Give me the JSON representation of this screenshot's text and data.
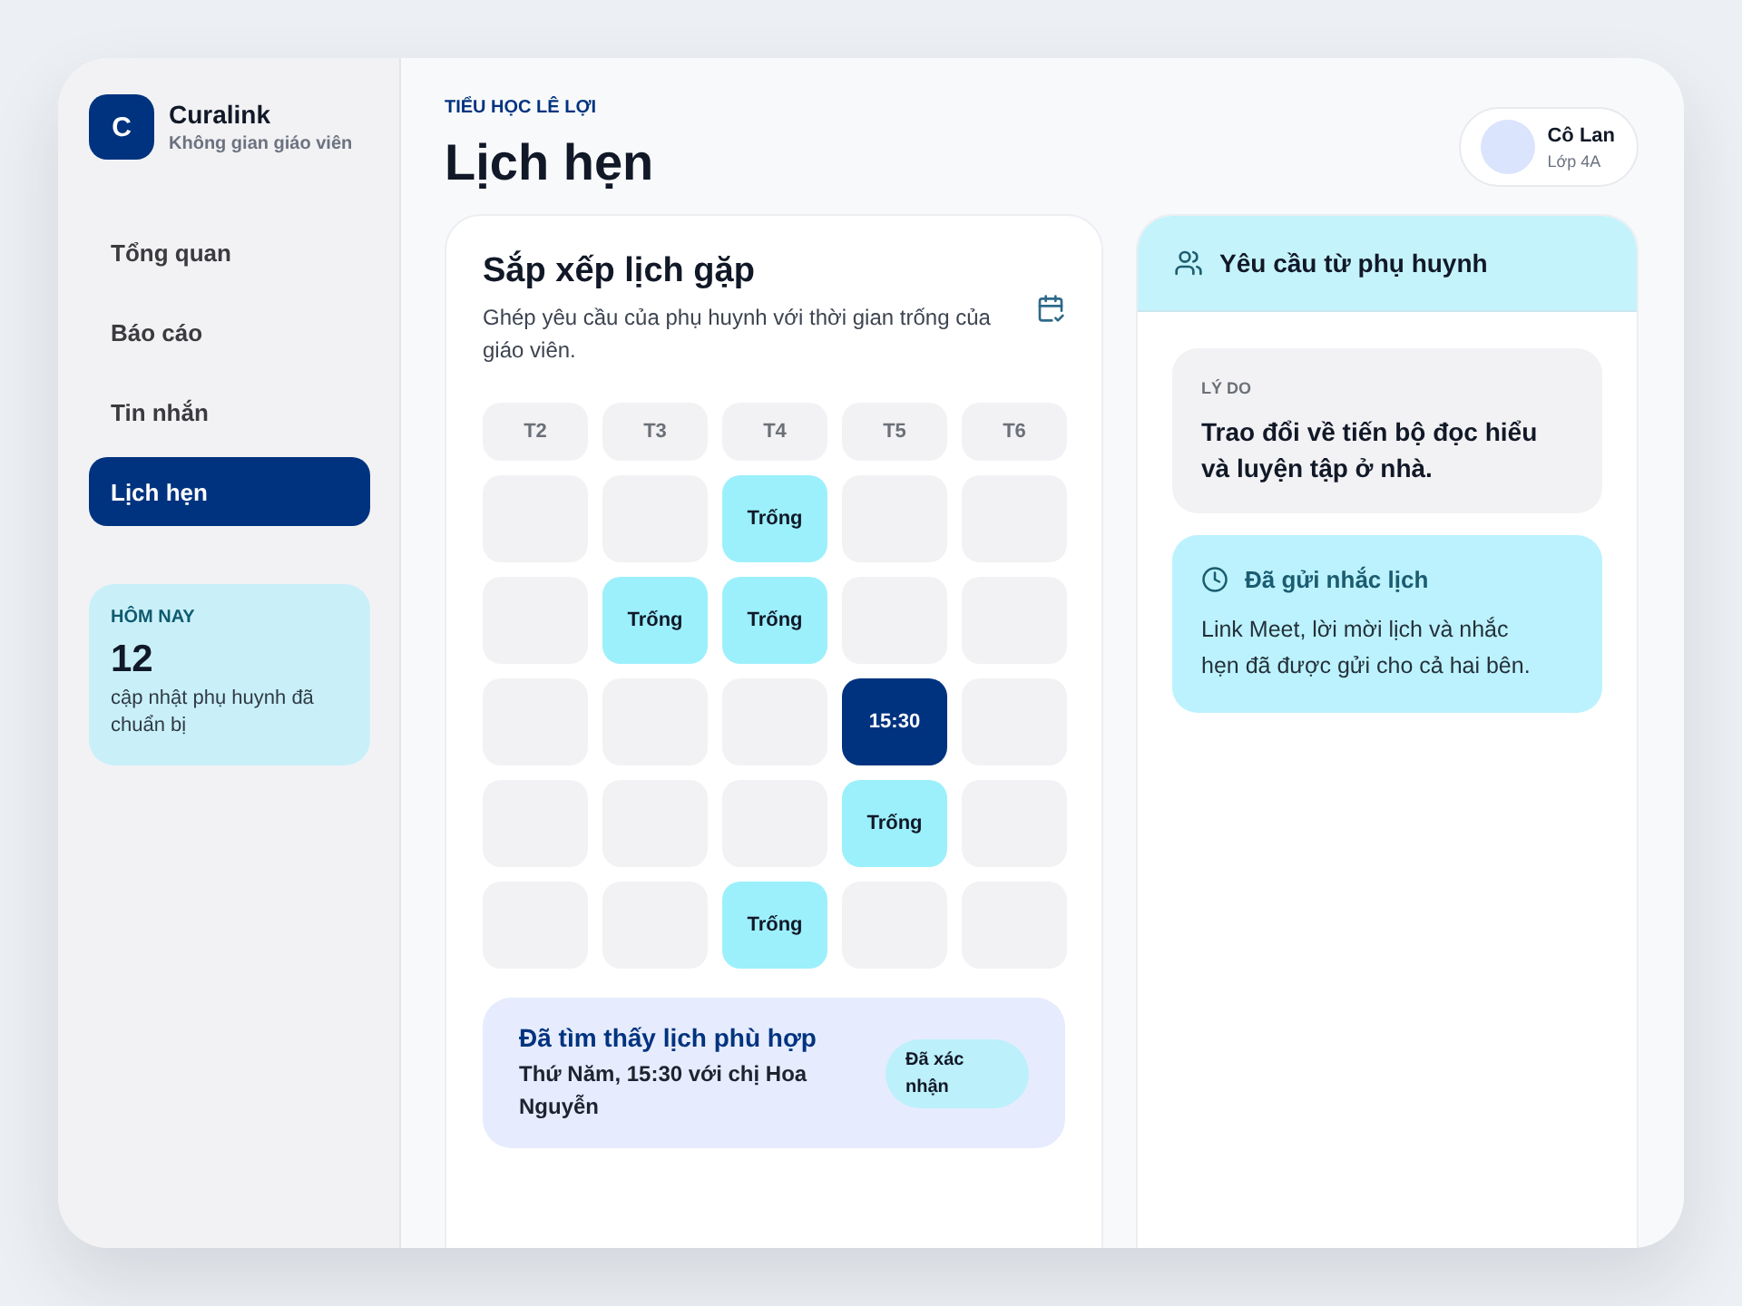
{
  "sidebar": {
    "logo": "C",
    "brand": "Curalink",
    "subtitle": "Không gian giáo viên",
    "items": [
      {
        "label": "Tổng quan",
        "selected": false
      },
      {
        "label": "Báo cáo",
        "selected": false
      },
      {
        "label": "Tin nhắn",
        "selected": false
      },
      {
        "label": "Lịch hẹn",
        "selected": true
      }
    ],
    "today": {
      "label": "HÔM NAY",
      "count": "12",
      "text": "cập nhật phụ huynh đã chuẩn bị"
    }
  },
  "header": {
    "school": "TIỂU HỌC LÊ LỢI",
    "title": "Lịch hẹn",
    "profile": {
      "name": "Cô Lan",
      "class": "Lớp 4A"
    }
  },
  "scheduler": {
    "title": "Sắp xếp lịch gặp",
    "subtitle": "Ghép yêu cầu của phụ huynh với thời gian trống của giáo viên.",
    "days": [
      "T2",
      "T3",
      "T4",
      "T5",
      "T6"
    ],
    "rows": [
      [
        {
          "kind": "empty"
        },
        {
          "kind": "empty"
        },
        {
          "kind": "free",
          "label": "Trống"
        },
        {
          "kind": "empty"
        },
        {
          "kind": "empty"
        }
      ],
      [
        {
          "kind": "empty"
        },
        {
          "kind": "free",
          "label": "Trống"
        },
        {
          "kind": "free",
          "label": "Trống"
        },
        {
          "kind": "empty"
        },
        {
          "kind": "empty"
        }
      ],
      [
        {
          "kind": "empty"
        },
        {
          "kind": "empty"
        },
        {
          "kind": "empty"
        },
        {
          "kind": "booked",
          "label": "15:30"
        },
        {
          "kind": "empty"
        }
      ],
      [
        {
          "kind": "empty"
        },
        {
          "kind": "empty"
        },
        {
          "kind": "empty"
        },
        {
          "kind": "free",
          "label": "Trống"
        },
        {
          "kind": "empty"
        }
      ],
      [
        {
          "kind": "empty"
        },
        {
          "kind": "empty"
        },
        {
          "kind": "free",
          "label": "Trống"
        },
        {
          "kind": "empty"
        },
        {
          "kind": "empty"
        }
      ]
    ],
    "match": {
      "title": "Đã tìm thấy lịch phù hợp",
      "text": "Thứ Năm, 15:30 với chị Hoa Nguyễn",
      "badge": "Đã xác nhận"
    }
  },
  "request_panel": {
    "title": "Yêu cầu từ phụ huynh",
    "reason": {
      "label": "LÝ DO",
      "text": "Trao đổi về tiến bộ đọc hiểu và luyện tập ở nhà."
    },
    "reminder": {
      "title": "Đã gửi nhắc lịch",
      "text": "Link Meet, lời mời lịch và nhắc hẹn đã được gửi cho cả hai bên."
    }
  }
}
